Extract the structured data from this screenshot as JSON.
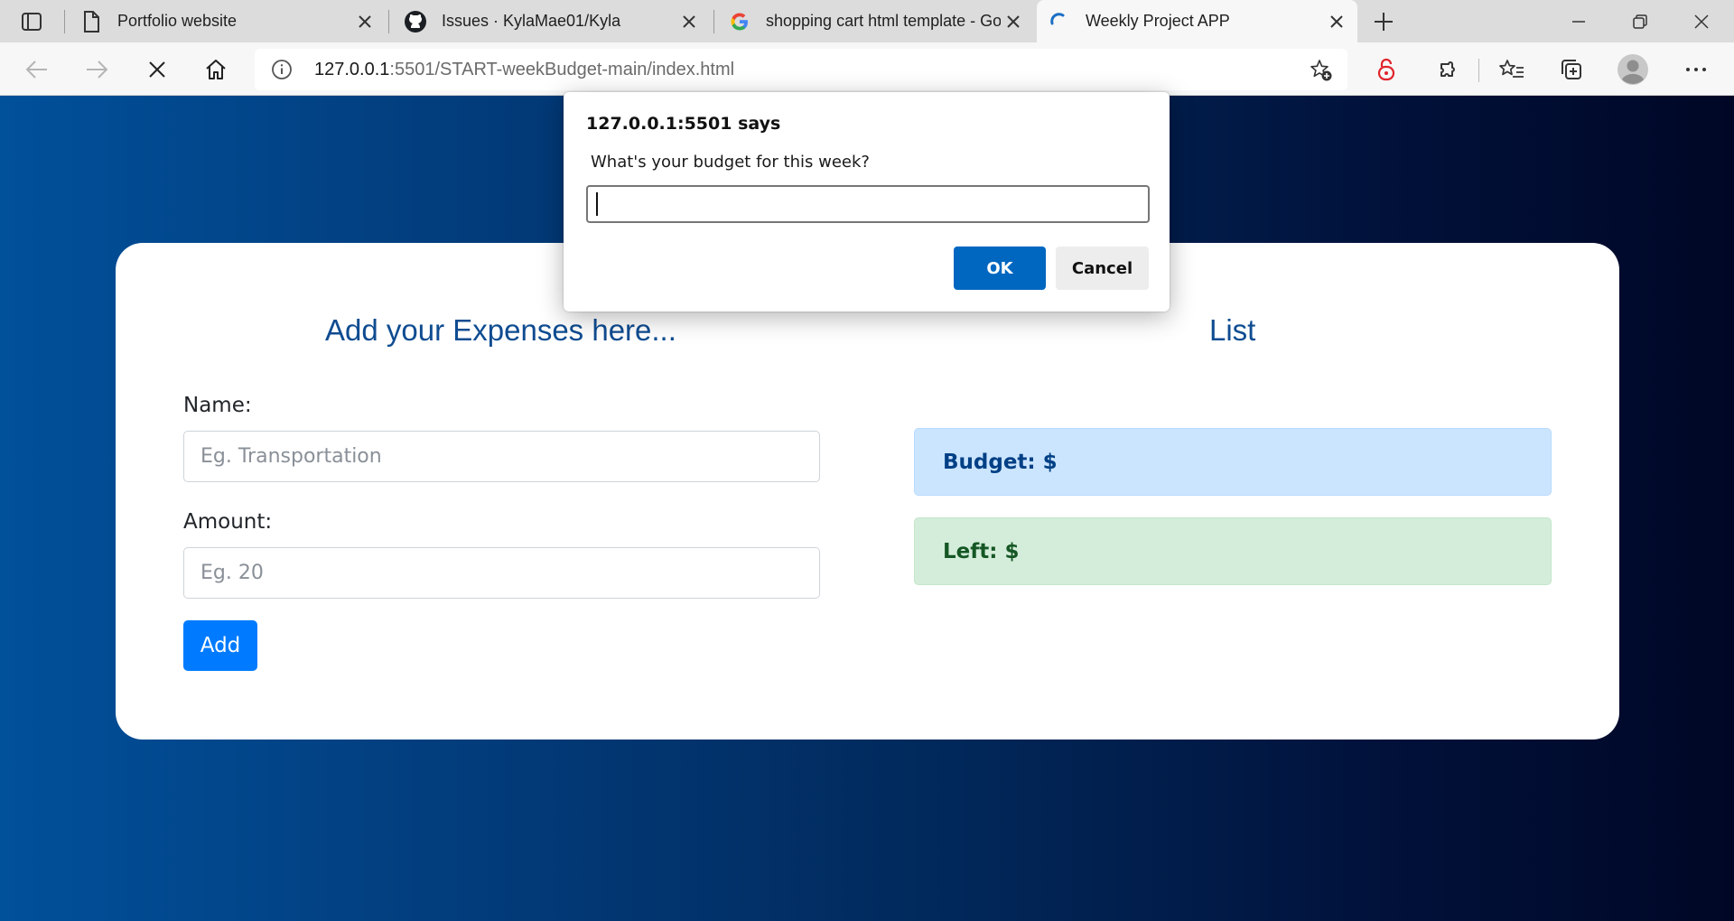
{
  "browser": {
    "tabs": [
      {
        "title": "Portfolio website",
        "icon": "page-icon",
        "active": false
      },
      {
        "title": "Issues · KylaMae01/Kyla",
        "icon": "github-icon",
        "active": false
      },
      {
        "title": "shopping cart html template - Go",
        "icon": "google-icon",
        "active": false
      },
      {
        "title": "Weekly Project APP",
        "icon": "loading-spinner-icon",
        "active": true
      }
    ],
    "url_host": "127.0.0.1",
    "url_rest": ":5501/START-weekBudget-main/index.html"
  },
  "dialog": {
    "title": "127.0.0.1:5501 says",
    "message": "What's your budget for this week?",
    "input_value": "",
    "ok_label": "OK",
    "cancel_label": "Cancel"
  },
  "app": {
    "form_title": "Add your Expenses here...",
    "name_label": "Name:",
    "name_placeholder": "Eg. Transportation",
    "amount_label": "Amount:",
    "amount_placeholder": "Eg. 20",
    "add_label": "Add",
    "list_title": "List",
    "budget_text": "Budget: $",
    "left_text": "Left: $"
  },
  "colors": {
    "accent": "#007bff",
    "title_blue": "#0f4c91",
    "budget_bg": "#cce5ff",
    "left_bg": "#d4edda",
    "dialog_ok": "#0067c0"
  }
}
